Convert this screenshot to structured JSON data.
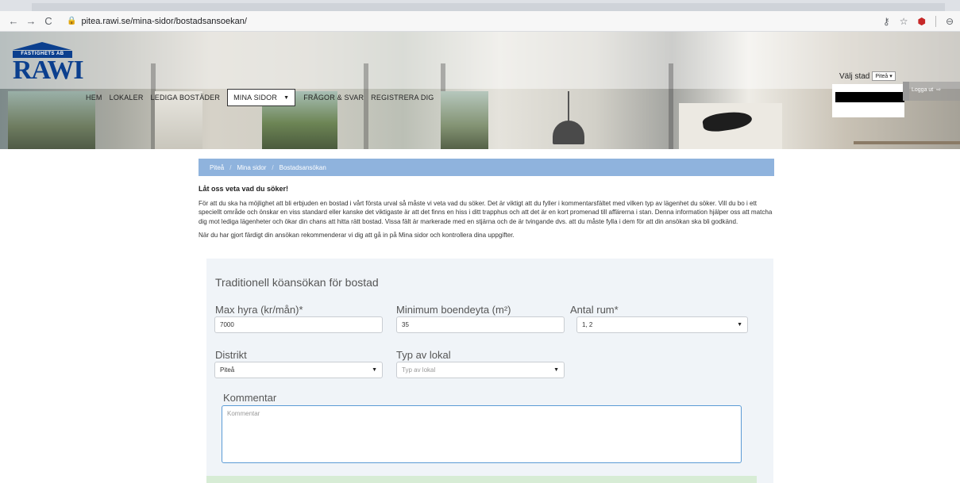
{
  "browser": {
    "url": "pitea.rawi.se/mina-sidor/bostadsansoekan/",
    "back_glyph": "←",
    "forward_glyph": "→",
    "reload_glyph": "C",
    "lock_glyph": "🔒",
    "key_glyph": "⚷",
    "star_glyph": "☆",
    "ext_glyph": "⬢",
    "account_glyph": "⊖"
  },
  "header": {
    "logo_sub": "FASTIGHETS AB",
    "logo_main": "RAWI",
    "nav": {
      "home": "HEM",
      "premises": "LOKALER",
      "available": "LEDIGA BOSTÄDER",
      "mypages": "MINA SIDOR",
      "faq": "FRÅGOR & SVAR",
      "register": "REGISTRERA DIG"
    },
    "city_label": "Välj stad",
    "city_value": "Piteå",
    "logout": "Logga ut"
  },
  "breadcrumb": [
    "Piteå",
    "Mina sidor",
    "Bostadsansökan"
  ],
  "intro": {
    "heading": "Låt oss veta vad du söker!",
    "paragraph": "För att du ska ha möjlighet att bli erbjuden en bostad i vårt första urval så måste vi veta vad du söker. Det är viktigt att du fyller i kommentarsfältet med vilken typ av lägenhet du söker. Vill du bo i ett speciellt område och önskar en viss standard eller kanske det viktigaste är att det finns en hiss i ditt trapphus och att det är en kort promenad till affärerna i stan. Denna information hjälper oss att matcha dig mot lediga lägenheter och ökar din chans att hitta rätt bostad. Vissa fält är markerade med en stjärna och de är tvingande dvs. att du måste fylla i dem för att din ansökan ska bli godkänd.",
    "paragraph2": "När du har gjort färdigt din ansökan rekommenderar vi dig att gå in på Mina sidor och kontrollera dina uppgifter."
  },
  "form": {
    "title": "Traditionell köansökan för bostad",
    "max_rent_label": "Max hyra (kr/mån)*",
    "max_rent_value": "7000",
    "min_area_label": "Minimum boendeyta (m²)",
    "min_area_value": "35",
    "rooms_label": "Antal rum*",
    "rooms_value": "1, 2",
    "district_label": "Distrikt",
    "district_value": "Piteå",
    "type_label": "Typ av lokal",
    "type_placeholder": "Typ av lokal",
    "comment_label": "Kommentar",
    "comment_placeholder": "Kommentar"
  },
  "colors": {
    "brand": "#0b3f8e",
    "breadcrumb_bg": "#8fb3dd",
    "form_bg": "#f0f4f8",
    "focus_border": "#5b9bd5"
  }
}
